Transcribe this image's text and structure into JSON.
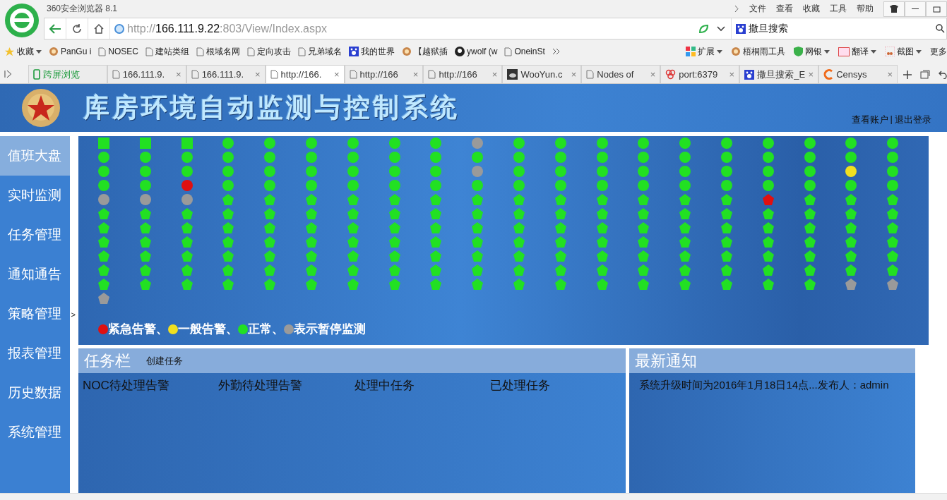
{
  "browser": {
    "title": "360安全浏览器 8.1",
    "menu": [
      "文件",
      "查看",
      "收藏",
      "工具",
      "帮助"
    ],
    "address": {
      "scheme": "http://",
      "host": "166.111.9.22",
      "path": ":803/View/Index.aspx"
    },
    "search_engine": "撒旦搜索",
    "bookmarks": [
      {
        "label": "收藏",
        "kind": "star"
      },
      {
        "label": "PanGu i",
        "kind": "logo"
      },
      {
        "label": "NOSEC",
        "kind": "page"
      },
      {
        "label": "建站类组",
        "kind": "page"
      },
      {
        "label": "根域名网",
        "kind": "page"
      },
      {
        "label": "定向攻击",
        "kind": "page"
      },
      {
        "label": "兄弟域名",
        "kind": "page"
      },
      {
        "label": "我的世界",
        "kind": "paw"
      },
      {
        "label": "【越狱插",
        "kind": "logo"
      },
      {
        "label": "ywolf (w",
        "kind": "github"
      },
      {
        "label": "OneinSt",
        "kind": "page"
      }
    ],
    "tools": [
      {
        "label": "扩展",
        "kind": "grid"
      },
      {
        "label": "梧桐雨工具",
        "kind": "logo"
      },
      {
        "label": "网银",
        "kind": "shield"
      },
      {
        "label": "翻译",
        "kind": "translate"
      },
      {
        "label": "截图",
        "kind": "scissors"
      },
      {
        "label": "更多",
        "kind": "none"
      }
    ],
    "tabs": [
      {
        "label": "跨屏浏览",
        "kind": "phone",
        "selected": false
      },
      {
        "label": "166.111.9.",
        "close": "×",
        "kind": "page",
        "selected": false
      },
      {
        "label": "166.111.9.",
        "close": "×",
        "kind": "page",
        "selected": false
      },
      {
        "label": "http://166.",
        "close": "×",
        "kind": "page",
        "selected": true
      },
      {
        "label": "http://166",
        "close": "×",
        "kind": "page",
        "selected": false
      },
      {
        "label": "http://166",
        "close": "×",
        "kind": "page",
        "selected": false
      },
      {
        "label": "WooYun.c",
        "close": "×",
        "kind": "cloud",
        "selected": false
      },
      {
        "label": "Nodes of",
        "close": "×",
        "kind": "page",
        "selected": false
      },
      {
        "label": "port:6379",
        "close": "×",
        "kind": "rings",
        "selected": false
      },
      {
        "label": "撒旦搜索_E",
        "close": "×",
        "kind": "paw",
        "selected": false
      },
      {
        "label": "Censys",
        "close": "×",
        "kind": "c",
        "selected": false
      }
    ]
  },
  "header": {
    "title": "库房环境自动监测与控制系统",
    "account": "查看账户",
    "separator": "|",
    "logout": "退出登录"
  },
  "sidebar": {
    "items": [
      {
        "label": "值班大盘",
        "selected": true
      },
      {
        "label": "实时监测",
        "selected": false
      },
      {
        "label": "任务管理",
        "selected": false
      },
      {
        "label": "通知通告",
        "selected": false
      },
      {
        "label": "策略管理",
        "selected": false
      },
      {
        "label": "报表管理",
        "selected": false
      },
      {
        "label": "历史数据",
        "selected": false
      },
      {
        "label": "系统管理",
        "selected": false
      }
    ],
    "toggle": ">"
  },
  "monitor": {
    "columns": [
      [
        {
          "kind": "square",
          "color": "#22e022"
        },
        {
          "kind": "circle",
          "color": "#22e022"
        },
        {
          "kind": "circle",
          "color": "#22e022"
        },
        {
          "kind": "circle",
          "color": "#22e022"
        },
        {
          "kind": "circle",
          "color": "#9a9a9a"
        },
        {
          "kind": "pentagon",
          "color": "#22e022"
        },
        {
          "kind": "pentagon",
          "color": "#22e022"
        },
        {
          "kind": "pentagon",
          "color": "#22e022"
        },
        {
          "kind": "pentagon",
          "color": "#22e022"
        },
        {
          "kind": "pentagon",
          "color": "#22e022"
        },
        {
          "kind": "pentagon",
          "color": "#22e022"
        },
        {
          "kind": "pentagon",
          "color": "#9a9a9a"
        }
      ],
      [
        {
          "kind": "square",
          "color": "#22e022"
        },
        {
          "kind": "circle",
          "color": "#22e022"
        },
        {
          "kind": "circle",
          "color": "#22e022"
        },
        {
          "kind": "circle",
          "color": "#22e022"
        },
        {
          "kind": "circle",
          "color": "#9a9a9a"
        },
        {
          "kind": "pentagon",
          "color": "#22e022"
        },
        {
          "kind": "pentagon",
          "color": "#22e022"
        },
        {
          "kind": "pentagon",
          "color": "#22e022"
        },
        {
          "kind": "pentagon",
          "color": "#22e022"
        },
        {
          "kind": "pentagon",
          "color": "#22e022"
        },
        {
          "kind": "pentagon",
          "color": "#22e022"
        }
      ],
      [
        {
          "kind": "square",
          "color": "#22e022"
        },
        {
          "kind": "circle",
          "color": "#22e022"
        },
        {
          "kind": "circle",
          "color": "#22e022"
        },
        {
          "kind": "circle",
          "color": "#e01010"
        },
        {
          "kind": "circle",
          "color": "#9a9a9a"
        },
        {
          "kind": "pentagon",
          "color": "#22e022"
        },
        {
          "kind": "pentagon",
          "color": "#22e022"
        },
        {
          "kind": "pentagon",
          "color": "#22e022"
        },
        {
          "kind": "pentagon",
          "color": "#22e022"
        },
        {
          "kind": "pentagon",
          "color": "#22e022"
        },
        {
          "kind": "pentagon",
          "color": "#22e022"
        }
      ],
      [
        {
          "kind": "circle",
          "color": "#22e022"
        },
        {
          "kind": "circle",
          "color": "#22e022"
        },
        {
          "kind": "circle",
          "color": "#22e022"
        },
        {
          "kind": "circle",
          "color": "#22e022"
        },
        {
          "kind": "pentagon",
          "color": "#22e022"
        },
        {
          "kind": "pentagon",
          "color": "#22e022"
        },
        {
          "kind": "pentagon",
          "color": "#22e022"
        },
        {
          "kind": "pentagon",
          "color": "#22e022"
        },
        {
          "kind": "pentagon",
          "color": "#22e022"
        },
        {
          "kind": "pentagon",
          "color": "#22e022"
        },
        {
          "kind": "pentagon",
          "color": "#22e022"
        }
      ],
      [
        {
          "kind": "circle",
          "color": "#22e022"
        },
        {
          "kind": "circle",
          "color": "#22e022"
        },
        {
          "kind": "circle",
          "color": "#22e022"
        },
        {
          "kind": "circle",
          "color": "#22e022"
        },
        {
          "kind": "pentagon",
          "color": "#22e022"
        },
        {
          "kind": "pentagon",
          "color": "#22e022"
        },
        {
          "kind": "pentagon",
          "color": "#22e022"
        },
        {
          "kind": "pentagon",
          "color": "#22e022"
        },
        {
          "kind": "pentagon",
          "color": "#22e022"
        },
        {
          "kind": "pentagon",
          "color": "#22e022"
        },
        {
          "kind": "pentagon",
          "color": "#22e022"
        }
      ],
      [
        {
          "kind": "circle",
          "color": "#22e022"
        },
        {
          "kind": "circle",
          "color": "#22e022"
        },
        {
          "kind": "circle",
          "color": "#22e022"
        },
        {
          "kind": "circle",
          "color": "#22e022"
        },
        {
          "kind": "pentagon",
          "color": "#22e022"
        },
        {
          "kind": "pentagon",
          "color": "#22e022"
        },
        {
          "kind": "pentagon",
          "color": "#22e022"
        },
        {
          "kind": "pentagon",
          "color": "#22e022"
        },
        {
          "kind": "pentagon",
          "color": "#22e022"
        },
        {
          "kind": "pentagon",
          "color": "#22e022"
        },
        {
          "kind": "pentagon",
          "color": "#22e022"
        }
      ],
      [
        {
          "kind": "circle",
          "color": "#22e022"
        },
        {
          "kind": "circle",
          "color": "#22e022"
        },
        {
          "kind": "circle",
          "color": "#22e022"
        },
        {
          "kind": "circle",
          "color": "#22e022"
        },
        {
          "kind": "pentagon",
          "color": "#22e022"
        },
        {
          "kind": "pentagon",
          "color": "#22e022"
        },
        {
          "kind": "pentagon",
          "color": "#22e022"
        },
        {
          "kind": "pentagon",
          "color": "#22e022"
        },
        {
          "kind": "pentagon",
          "color": "#22e022"
        },
        {
          "kind": "pentagon",
          "color": "#22e022"
        },
        {
          "kind": "pentagon",
          "color": "#22e022"
        }
      ],
      [
        {
          "kind": "circle",
          "color": "#22e022"
        },
        {
          "kind": "circle",
          "color": "#22e022"
        },
        {
          "kind": "circle",
          "color": "#22e022"
        },
        {
          "kind": "circle",
          "color": "#22e022"
        },
        {
          "kind": "pentagon",
          "color": "#22e022"
        },
        {
          "kind": "pentagon",
          "color": "#22e022"
        },
        {
          "kind": "pentagon",
          "color": "#22e022"
        },
        {
          "kind": "pentagon",
          "color": "#22e022"
        },
        {
          "kind": "pentagon",
          "color": "#22e022"
        },
        {
          "kind": "pentagon",
          "color": "#22e022"
        },
        {
          "kind": "pentagon",
          "color": "#22e022"
        }
      ],
      [
        {
          "kind": "circle",
          "color": "#22e022"
        },
        {
          "kind": "circle",
          "color": "#22e022"
        },
        {
          "kind": "circle",
          "color": "#22e022"
        },
        {
          "kind": "circle",
          "color": "#22e022"
        },
        {
          "kind": "pentagon",
          "color": "#22e022"
        },
        {
          "kind": "pentagon",
          "color": "#22e022"
        },
        {
          "kind": "pentagon",
          "color": "#22e022"
        },
        {
          "kind": "pentagon",
          "color": "#22e022"
        },
        {
          "kind": "pentagon",
          "color": "#22e022"
        },
        {
          "kind": "pentagon",
          "color": "#22e022"
        },
        {
          "kind": "pentagon",
          "color": "#22e022"
        }
      ],
      [
        {
          "kind": "circle",
          "color": "#9a9a9a"
        },
        {
          "kind": "circle",
          "color": "#22e022"
        },
        {
          "kind": "circle",
          "color": "#9a9a9a"
        },
        {
          "kind": "circle",
          "color": "#22e022"
        },
        {
          "kind": "pentagon",
          "color": "#22e022"
        },
        {
          "kind": "pentagon",
          "color": "#22e022"
        },
        {
          "kind": "pentagon",
          "color": "#22e022"
        },
        {
          "kind": "pentagon",
          "color": "#22e022"
        },
        {
          "kind": "pentagon",
          "color": "#22e022"
        },
        {
          "kind": "pentagon",
          "color": "#22e022"
        },
        {
          "kind": "pentagon",
          "color": "#22e022"
        }
      ],
      [
        {
          "kind": "circle",
          "color": "#22e022"
        },
        {
          "kind": "circle",
          "color": "#22e022"
        },
        {
          "kind": "circle",
          "color": "#22e022"
        },
        {
          "kind": "circle",
          "color": "#22e022"
        },
        {
          "kind": "pentagon",
          "color": "#22e022"
        },
        {
          "kind": "pentagon",
          "color": "#22e022"
        },
        {
          "kind": "pentagon",
          "color": "#22e022"
        },
        {
          "kind": "pentagon",
          "color": "#22e022"
        },
        {
          "kind": "pentagon",
          "color": "#22e022"
        },
        {
          "kind": "pentagon",
          "color": "#22e022"
        },
        {
          "kind": "pentagon",
          "color": "#22e022"
        }
      ],
      [
        {
          "kind": "circle",
          "color": "#22e022"
        },
        {
          "kind": "circle",
          "color": "#22e022"
        },
        {
          "kind": "circle",
          "color": "#22e022"
        },
        {
          "kind": "circle",
          "color": "#22e022"
        },
        {
          "kind": "pentagon",
          "color": "#22e022"
        },
        {
          "kind": "pentagon",
          "color": "#22e022"
        },
        {
          "kind": "pentagon",
          "color": "#22e022"
        },
        {
          "kind": "pentagon",
          "color": "#22e022"
        },
        {
          "kind": "pentagon",
          "color": "#22e022"
        },
        {
          "kind": "pentagon",
          "color": "#22e022"
        },
        {
          "kind": "pentagon",
          "color": "#22e022"
        }
      ],
      [
        {
          "kind": "circle",
          "color": "#22e022"
        },
        {
          "kind": "circle",
          "color": "#22e022"
        },
        {
          "kind": "circle",
          "color": "#22e022"
        },
        {
          "kind": "circle",
          "color": "#22e022"
        },
        {
          "kind": "pentagon",
          "color": "#22e022"
        },
        {
          "kind": "pentagon",
          "color": "#22e022"
        },
        {
          "kind": "pentagon",
          "color": "#22e022"
        },
        {
          "kind": "pentagon",
          "color": "#22e022"
        },
        {
          "kind": "pentagon",
          "color": "#22e022"
        },
        {
          "kind": "pentagon",
          "color": "#22e022"
        },
        {
          "kind": "pentagon",
          "color": "#22e022"
        }
      ],
      [
        {
          "kind": "circle",
          "color": "#22e022"
        },
        {
          "kind": "circle",
          "color": "#22e022"
        },
        {
          "kind": "circle",
          "color": "#22e022"
        },
        {
          "kind": "circle",
          "color": "#22e022"
        },
        {
          "kind": "pentagon",
          "color": "#22e022"
        },
        {
          "kind": "pentagon",
          "color": "#22e022"
        },
        {
          "kind": "pentagon",
          "color": "#22e022"
        },
        {
          "kind": "pentagon",
          "color": "#22e022"
        },
        {
          "kind": "pentagon",
          "color": "#22e022"
        },
        {
          "kind": "pentagon",
          "color": "#22e022"
        },
        {
          "kind": "pentagon",
          "color": "#22e022"
        }
      ],
      [
        {
          "kind": "circle",
          "color": "#22e022"
        },
        {
          "kind": "circle",
          "color": "#22e022"
        },
        {
          "kind": "circle",
          "color": "#22e022"
        },
        {
          "kind": "circle",
          "color": "#22e022"
        },
        {
          "kind": "pentagon",
          "color": "#22e022"
        },
        {
          "kind": "pentagon",
          "color": "#22e022"
        },
        {
          "kind": "pentagon",
          "color": "#22e022"
        },
        {
          "kind": "pentagon",
          "color": "#22e022"
        },
        {
          "kind": "pentagon",
          "color": "#22e022"
        },
        {
          "kind": "pentagon",
          "color": "#22e022"
        },
        {
          "kind": "pentagon",
          "color": "#22e022"
        }
      ],
      [
        {
          "kind": "circle",
          "color": "#22e022"
        },
        {
          "kind": "circle",
          "color": "#22e022"
        },
        {
          "kind": "circle",
          "color": "#22e022"
        },
        {
          "kind": "circle",
          "color": "#22e022"
        },
        {
          "kind": "pentagon",
          "color": "#22e022"
        },
        {
          "kind": "pentagon",
          "color": "#22e022"
        },
        {
          "kind": "pentagon",
          "color": "#22e022"
        },
        {
          "kind": "pentagon",
          "color": "#22e022"
        },
        {
          "kind": "pentagon",
          "color": "#22e022"
        },
        {
          "kind": "pentagon",
          "color": "#22e022"
        },
        {
          "kind": "pentagon",
          "color": "#22e022"
        }
      ],
      [
        {
          "kind": "circle",
          "color": "#22e022"
        },
        {
          "kind": "circle",
          "color": "#22e022"
        },
        {
          "kind": "circle",
          "color": "#22e022"
        },
        {
          "kind": "circle",
          "color": "#22e022"
        },
        {
          "kind": "pentagon",
          "color": "#e01010"
        },
        {
          "kind": "pentagon",
          "color": "#22e022"
        },
        {
          "kind": "pentagon",
          "color": "#22e022"
        },
        {
          "kind": "pentagon",
          "color": "#22e022"
        },
        {
          "kind": "pentagon",
          "color": "#22e022"
        },
        {
          "kind": "pentagon",
          "color": "#22e022"
        },
        {
          "kind": "pentagon",
          "color": "#22e022"
        }
      ],
      [
        {
          "kind": "circle",
          "color": "#22e022"
        },
        {
          "kind": "circle",
          "color": "#22e022"
        },
        {
          "kind": "circle",
          "color": "#22e022"
        },
        {
          "kind": "circle",
          "color": "#22e022"
        },
        {
          "kind": "pentagon",
          "color": "#22e022"
        },
        {
          "kind": "pentagon",
          "color": "#22e022"
        },
        {
          "kind": "pentagon",
          "color": "#22e022"
        },
        {
          "kind": "pentagon",
          "color": "#22e022"
        },
        {
          "kind": "pentagon",
          "color": "#22e022"
        },
        {
          "kind": "pentagon",
          "color": "#22e022"
        },
        {
          "kind": "pentagon",
          "color": "#22e022"
        }
      ],
      [
        {
          "kind": "circle",
          "color": "#22e022"
        },
        {
          "kind": "circle",
          "color": "#22e022"
        },
        {
          "kind": "circle",
          "color": "#f0e020"
        },
        {
          "kind": "circle",
          "color": "#22e022"
        },
        {
          "kind": "pentagon",
          "color": "#22e022"
        },
        {
          "kind": "pentagon",
          "color": "#22e022"
        },
        {
          "kind": "pentagon",
          "color": "#22e022"
        },
        {
          "kind": "pentagon",
          "color": "#22e022"
        },
        {
          "kind": "pentagon",
          "color": "#22e022"
        },
        {
          "kind": "pentagon",
          "color": "#22e022"
        },
        {
          "kind": "pentagon",
          "color": "#9a9a9a"
        }
      ],
      [
        {
          "kind": "circle",
          "color": "#22e022"
        },
        {
          "kind": "circle",
          "color": "#22e022"
        },
        {
          "kind": "circle",
          "color": "#22e022"
        },
        {
          "kind": "circle",
          "color": "#22e022"
        },
        {
          "kind": "pentagon",
          "color": "#22e022"
        },
        {
          "kind": "pentagon",
          "color": "#22e022"
        },
        {
          "kind": "pentagon",
          "color": "#22e022"
        },
        {
          "kind": "pentagon",
          "color": "#22e022"
        },
        {
          "kind": "pentagon",
          "color": "#22e022"
        },
        {
          "kind": "pentagon",
          "color": "#22e022"
        },
        {
          "kind": "pentagon",
          "color": "#9a9a9a"
        }
      ]
    ],
    "legend": [
      {
        "label": "紧急告警、",
        "color": "#e01010"
      },
      {
        "label": "一般告警、",
        "color": "#f0e020"
      },
      {
        "label": "正常、",
        "color": "#22e022"
      },
      {
        "label": "表示暂停监测",
        "color": "#9a9a9a"
      }
    ]
  },
  "tasks": {
    "title": "任务栏",
    "create": "创建任务",
    "columns": [
      "NOC待处理告警",
      "外勤待处理告警",
      "处理中任务",
      "已处理任务"
    ]
  },
  "notices": {
    "title": "最新通知",
    "items": [
      "系统升级时间为2016年1月18日14点...发布人：admin"
    ]
  }
}
